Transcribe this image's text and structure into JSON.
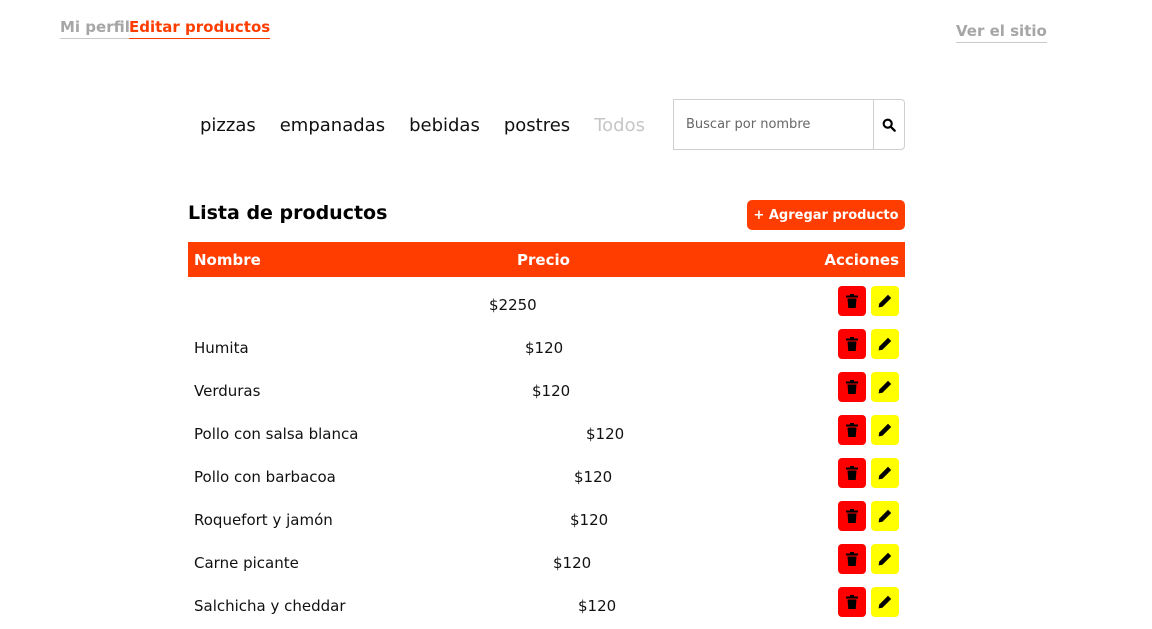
{
  "nav": {
    "profile": "Mi perfil",
    "edit_products": "Editar productos",
    "view_site": "Ver el sitio"
  },
  "filters": [
    "pizzas",
    "empanadas",
    "bebidas",
    "postres",
    "Todos"
  ],
  "search": {
    "placeholder": "Buscar por nombre",
    "value": "",
    "icon": "search-icon"
  },
  "list": {
    "title": "Lista de productos",
    "add_button": "+ Agregar producto"
  },
  "table": {
    "headers": {
      "name": "Nombre",
      "price": "Precio",
      "actions": "Acciones"
    },
    "rows": [
      {
        "name": "",
        "price": "$2250"
      },
      {
        "name": "Humita",
        "price": "$120"
      },
      {
        "name": "Verduras",
        "price": "$120"
      },
      {
        "name": "Pollo con salsa blanca",
        "price": "$120"
      },
      {
        "name": "Pollo con barbacoa",
        "price": "$120"
      },
      {
        "name": "Roquefort y jamón",
        "price": "$120"
      },
      {
        "name": "Carne picante",
        "price": "$120"
      },
      {
        "name": "Salchicha y cheddar",
        "price": "$120"
      }
    ],
    "action_icons": {
      "delete": "trash-icon",
      "edit": "pencil-icon"
    }
  },
  "colors": {
    "accent": "#ff3d00",
    "muted": "#a6a6a6",
    "delete": "#ff0000",
    "edit": "#ffff00"
  }
}
